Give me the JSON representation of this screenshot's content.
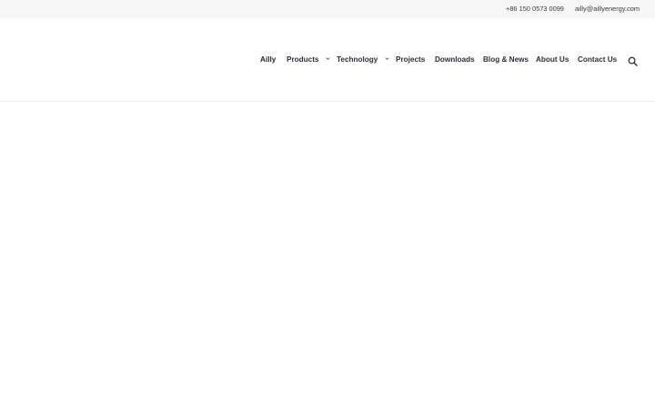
{
  "topbar": {
    "phone": "+86 150 0573 0099",
    "email": "ailly@aillyenergy.com"
  },
  "nav": {
    "items": [
      {
        "label": "Ailly",
        "has_dropdown": false
      },
      {
        "label": "Products",
        "has_dropdown": true
      },
      {
        "label": "Technology",
        "has_dropdown": true
      },
      {
        "label": "Projects",
        "has_dropdown": false
      },
      {
        "label": "Downloads",
        "has_dropdown": false
      },
      {
        "label": "Blog & News",
        "has_dropdown": false
      },
      {
        "label": "About Us",
        "has_dropdown": false
      },
      {
        "label": "Contact Us",
        "has_dropdown": false
      }
    ],
    "search_icon": "search-icon",
    "dropdown_icon": "chevron-down-icon"
  },
  "colors": {
    "topbar_bg": "#f6f6f7",
    "nav_text": "#2d2f3a",
    "divider": "#ececec"
  }
}
